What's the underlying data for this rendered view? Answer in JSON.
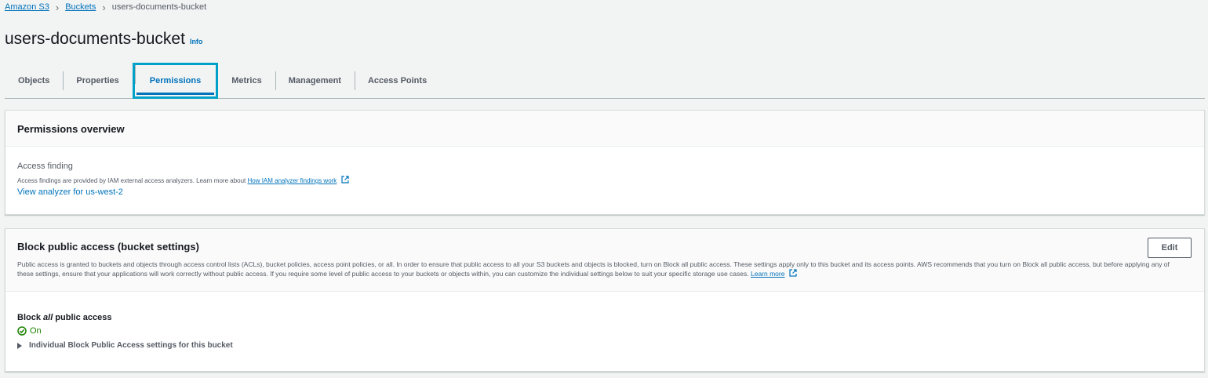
{
  "breadcrumb": {
    "items": [
      "Amazon S3",
      "Buckets"
    ],
    "current": "users-documents-bucket"
  },
  "page": {
    "title": "users-documents-bucket",
    "info_label": "Info"
  },
  "tabs": [
    {
      "label": "Objects"
    },
    {
      "label": "Properties"
    },
    {
      "label": "Permissions",
      "active": true
    },
    {
      "label": "Metrics"
    },
    {
      "label": "Management"
    },
    {
      "label": "Access Points"
    }
  ],
  "permissions_overview": {
    "title": "Permissions overview",
    "access_finding_label": "Access finding",
    "description": "Access findings are provided by IAM external access analyzers. Learn more about ",
    "learn_link": "How IAM analyzer findings work",
    "analyzer_link": "View analyzer for us-west-2"
  },
  "block_public_access": {
    "title": "Block public access (bucket settings)",
    "edit_label": "Edit",
    "description": "Public access is granted to buckets and objects through access control lists (ACLs), bucket policies, access point policies, or all. In order to ensure that public access to all your S3 buckets and objects is blocked, turn on Block all public access. These settings apply only to this bucket and its access points. AWS recommends that you turn on Block all public access, but before applying any of these settings, ensure that your applications will work correctly without public access. If you require some level of public access to your buckets or objects within, you can customize the individual settings below to suit your specific storage use cases. ",
    "learn_more": "Learn more",
    "block_label_prefix": "Block ",
    "block_label_emph": "all",
    "block_label_suffix": " public access",
    "status": "On",
    "expander_label": "Individual Block Public Access settings for this bucket"
  },
  "colors": {
    "link": "#0073bb",
    "success": "#1d8102",
    "active_highlight": "#00a1c9"
  }
}
